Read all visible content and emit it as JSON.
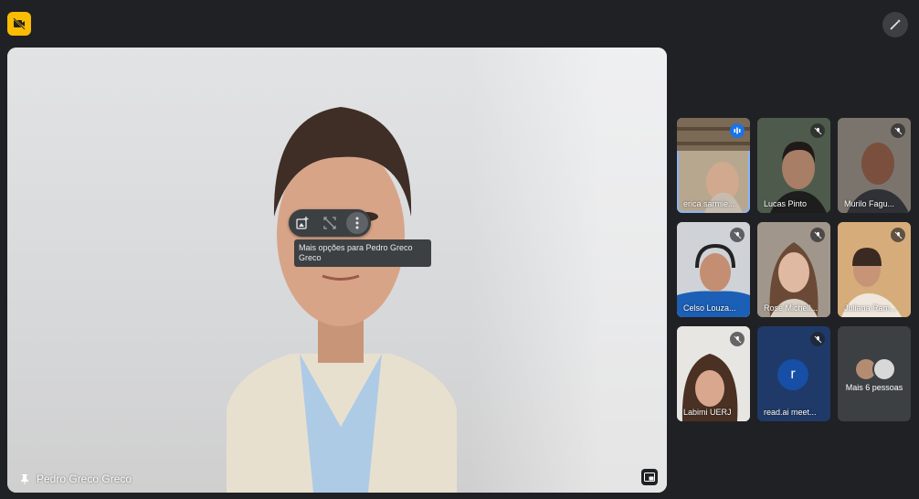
{
  "topbar": {
    "recording_icon": "recording-off-icon",
    "effects_icon": "magic-wand-icon"
  },
  "main": {
    "participant_name": "Pedro Greco Greco",
    "pin_icon": "pin-icon",
    "controls": {
      "icons": [
        "add-to-frame-icon",
        "fullscreen-off-icon",
        "more-vert-icon"
      ]
    },
    "tooltip": "Mais opções para Pedro Greco Greco"
  },
  "tiles": [
    {
      "name": "erica sarmie...",
      "state": "speaking",
      "color": "#8ab4f8"
    },
    {
      "name": "Lucas Pinto",
      "state": "muted"
    },
    {
      "name": "Murilo Fagu...",
      "state": "muted"
    },
    {
      "name": "Celso Louza...",
      "state": "muted"
    },
    {
      "name": "Rose Michell...",
      "state": "muted"
    },
    {
      "name": "Juliana Ram...",
      "state": "muted"
    },
    {
      "name": "Labimi UERJ",
      "state": "muted"
    },
    {
      "name": "read.ai meet...",
      "state": "muted",
      "avatar_letter": "r"
    },
    {
      "name": "Mais 6 pessoas",
      "state": "overflow"
    }
  ],
  "colors": {
    "background": "#202124",
    "tile": "#3c4043",
    "accent_blue": "#1a73e8",
    "recording_yellow": "#fbbc04"
  }
}
